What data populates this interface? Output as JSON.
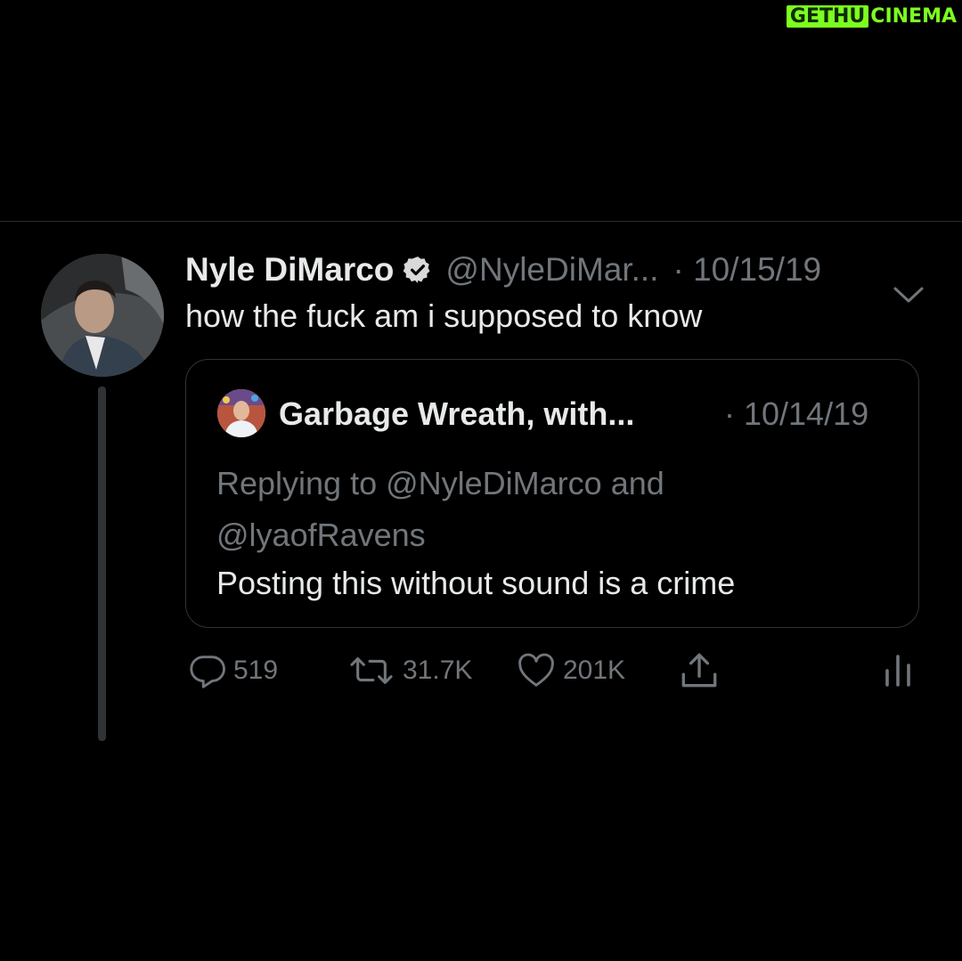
{
  "watermark": {
    "part1": "GETHU",
    "part2": "CINEMA"
  },
  "tweet": {
    "author_name": "Nyle DiMarco",
    "handle": "@NyleDiMar...",
    "date": "· 10/15/19",
    "text": "how the fuck am i supposed to know",
    "verified": true
  },
  "quoted": {
    "author_name": "Garbage Wreath, with...",
    "date": "· 10/14/19",
    "replying_line1": "Replying to @NyleDiMarco and",
    "replying_line2": "@lyaofRavens",
    "text": "Posting this without sound is a crime"
  },
  "actions": {
    "replies": "519",
    "retweets": "31.7K",
    "likes": "201K"
  },
  "icons": {
    "verified": "verified-badge-icon",
    "caret": "chevron-down-icon",
    "reply": "reply-bubble-icon",
    "retweet": "retweet-icon",
    "like": "heart-icon",
    "share": "share-icon",
    "analytics": "analytics-icon"
  },
  "colors": {
    "background": "#000000",
    "text_primary": "#e7e9ea",
    "text_secondary": "#71767b",
    "border": "#2f3336",
    "watermark_green": "#7cff1f"
  }
}
